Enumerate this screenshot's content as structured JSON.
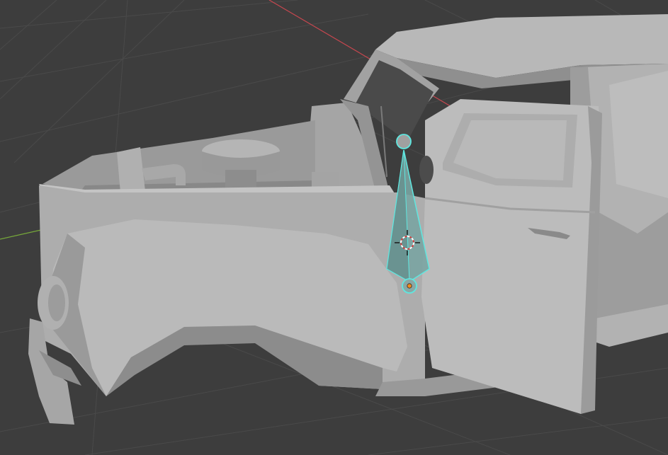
{
  "viewport": {
    "background": "#3d3d3d",
    "grid_color": "#4a4a4a",
    "x_axis_color": "#c8474f",
    "y_axis_color": "#76a83a"
  },
  "car": {
    "body_color": "#a9a9a9",
    "shadow_color": "#7e7e7e",
    "highlight_color": "#c2c2c2"
  },
  "bone": {
    "outline_color": "#5fe7e0",
    "fill_color": "#7aa4a2",
    "selected": true
  },
  "icons": {
    "cursor": "3d-cursor-icon",
    "origin": "object-origin-icon"
  },
  "origin_color": "#f08a1e"
}
